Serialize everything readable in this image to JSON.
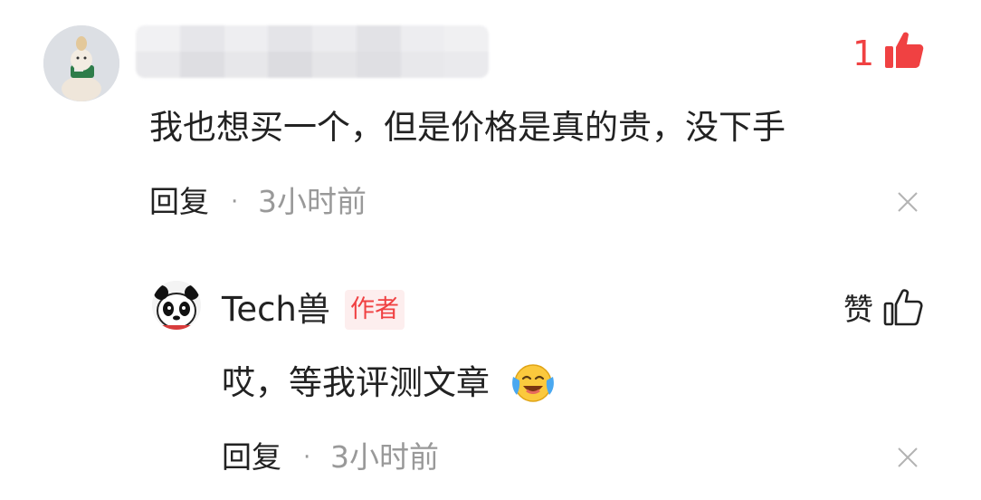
{
  "comment": {
    "like_count": "1",
    "text": "我也想买一个，但是价格是真的贵，没下手",
    "reply_label": "回复",
    "separator": "·",
    "time": "3小时前",
    "colors": {
      "like_active": "#f04142",
      "text": "#222222",
      "meta": "#999999"
    }
  },
  "reply": {
    "author_name": "Tech兽",
    "author_badge": "作者",
    "like_label": "赞",
    "text": "哎，等我评测文章",
    "emoji": "crying-laughing-emoji",
    "reply_label": "回复",
    "separator": "·",
    "time": "3小时前"
  }
}
